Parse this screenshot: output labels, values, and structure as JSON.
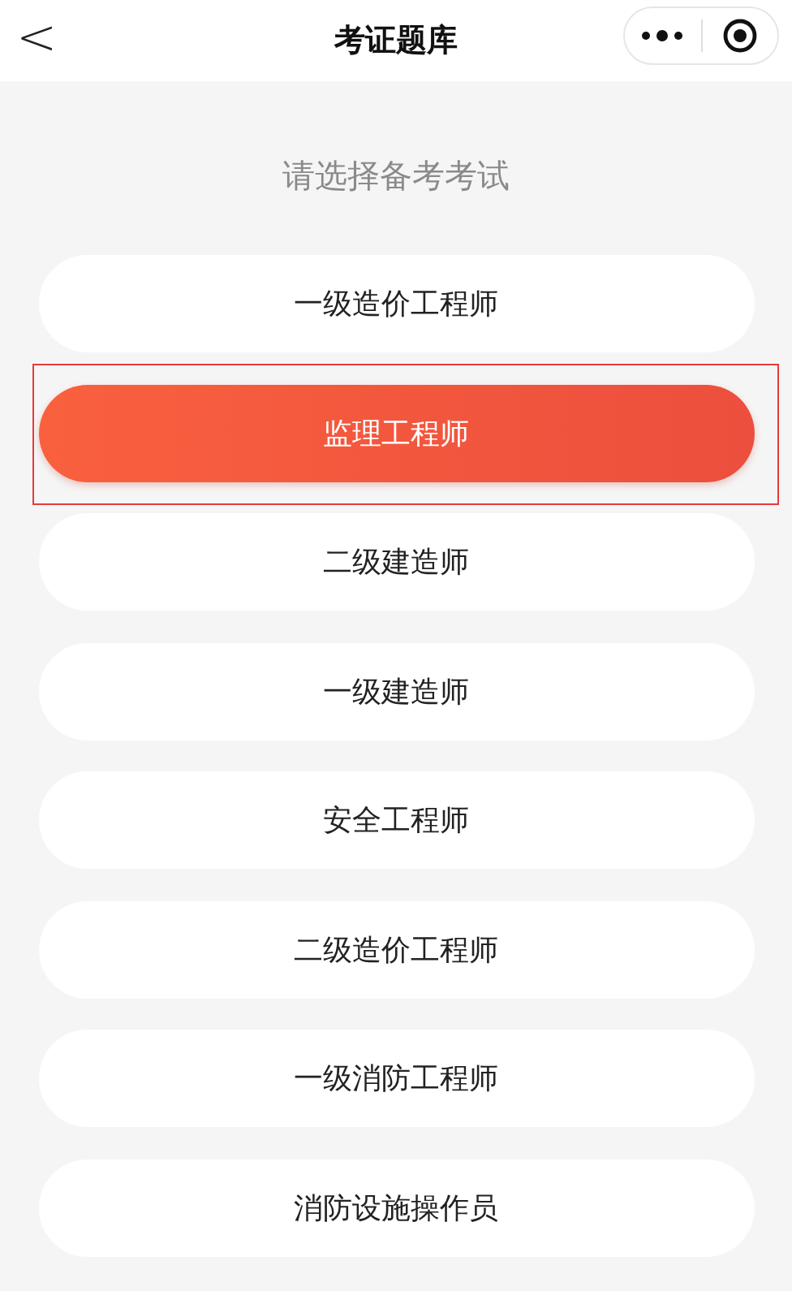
{
  "header": {
    "back": "<",
    "title": "考证题库"
  },
  "prompt": "请选择备考考试",
  "exams": [
    {
      "label": "一级造价工程师",
      "selected": false
    },
    {
      "label": "监理工程师",
      "selected": true
    },
    {
      "label": "二级建造师",
      "selected": false
    },
    {
      "label": "一级建造师",
      "selected": false
    },
    {
      "label": "安全工程师",
      "selected": false
    },
    {
      "label": "二级造价工程师",
      "selected": false
    },
    {
      "label": "一级消防工程师",
      "selected": false
    },
    {
      "label": "消防设施操作员",
      "selected": false
    }
  ]
}
